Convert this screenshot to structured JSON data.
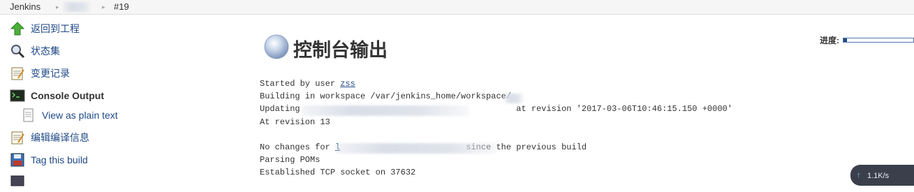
{
  "breadcrumb": {
    "root": "Jenkins",
    "separator": "▸",
    "build": "#19"
  },
  "sidebar": {
    "items": [
      {
        "label": "返回到工程",
        "icon": "up-arrow-icon"
      },
      {
        "label": "状态集",
        "icon": "magnifier-icon"
      },
      {
        "label": "变更记录",
        "icon": "notepad-icon"
      },
      {
        "label": "Console Output",
        "icon": "terminal-icon"
      },
      {
        "label": "View as plain text",
        "icon": "document-icon"
      },
      {
        "label": "编辑编译信息",
        "icon": "notepad-icon"
      },
      {
        "label": "Tag this build",
        "icon": "save-disk-icon"
      }
    ]
  },
  "page": {
    "title": "控制台输出",
    "progress_label": "进度:",
    "progress_fraction": 0.05
  },
  "console": {
    "line1_prefix": "Started by user ",
    "line1_user": "zss",
    "line2": "Building in workspace /var/jenkins_home/workspace/",
    "line3_prefix": "Updating ",
    "line3_suffix": "at revision '2017-03-06T10:46:15.150 +0000'",
    "line4": "At revision 13",
    "line6_prefix": "No changes for ",
    "line6_link": "l",
    "line6_suffix": "since the previous build",
    "line7": "Parsing POMs",
    "line8": "Established TCP socket on 37632"
  },
  "network_badge": {
    "arrow": "↑",
    "rate": "1.1K/s"
  },
  "colors": {
    "link": "#204a87",
    "breadcrumb_bg": "#f6f6f6",
    "badge_bg": "#3a3f4b"
  }
}
